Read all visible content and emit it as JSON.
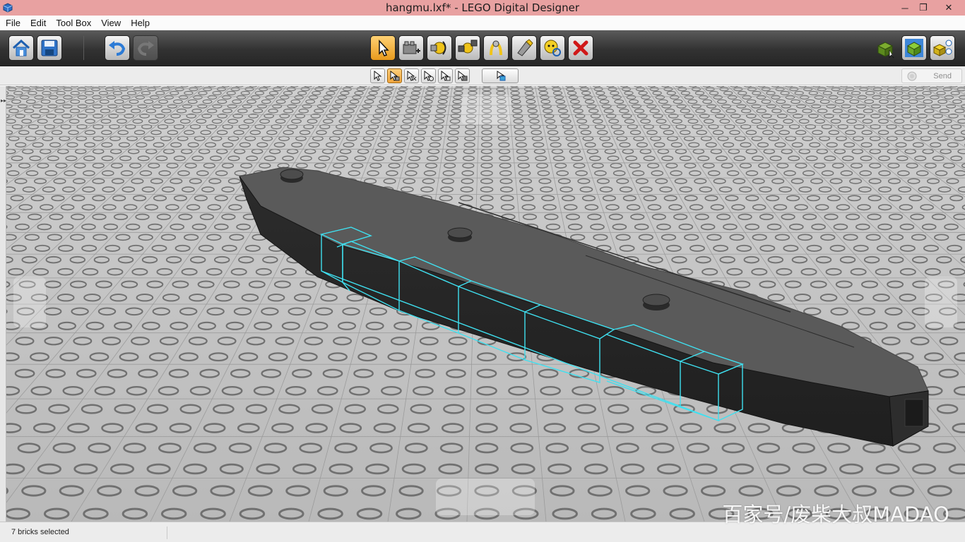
{
  "window": {
    "title": "hangmu.lxf* - LEGO Digital Designer",
    "min_glyph": "─",
    "max_glyph": "❐",
    "close_glyph": "✕"
  },
  "menu": [
    "File",
    "Edit",
    "Tool Box",
    "View",
    "Help"
  ],
  "toolbar": {
    "left": [
      {
        "name": "home-icon",
        "state": "normal"
      },
      {
        "name": "save-icon",
        "state": "normal"
      },
      {
        "name": "undo-icon",
        "state": "normal"
      },
      {
        "name": "redo-icon",
        "state": "disabled"
      }
    ],
    "center": [
      {
        "name": "select-tool-icon",
        "state": "active"
      },
      {
        "name": "clone-tool-icon",
        "state": "normal"
      },
      {
        "name": "hinge-tool-icon",
        "state": "normal"
      },
      {
        "name": "hinge-align-tool-icon",
        "state": "normal"
      },
      {
        "name": "flex-tool-icon",
        "state": "normal"
      },
      {
        "name": "paint-tool-icon",
        "state": "normal"
      },
      {
        "name": "hide-tool-icon",
        "state": "normal"
      },
      {
        "name": "delete-tool-icon",
        "state": "normal"
      }
    ],
    "right": [
      {
        "name": "build-mode-icon"
      },
      {
        "name": "view-mode-icon"
      },
      {
        "name": "building-guide-icon"
      }
    ]
  },
  "subtoolbar": {
    "select_modes": [
      "single-select-icon",
      "multi-select-icon",
      "connected-select-icon",
      "same-color-select-icon",
      "same-shape-select-icon",
      "same-brick-select-icon"
    ],
    "group_button": "group-icon",
    "send_label": "Send"
  },
  "status": {
    "text": "7 bricks selected"
  },
  "watermark": "百家号/废柴大叔MADAO",
  "colors": {
    "accent": "#f0a53c",
    "selection": "#3fe0f0",
    "hull": "#3a3a3a",
    "baseplate": "#bdbdbd",
    "titlebar": "#e8a1a1"
  }
}
